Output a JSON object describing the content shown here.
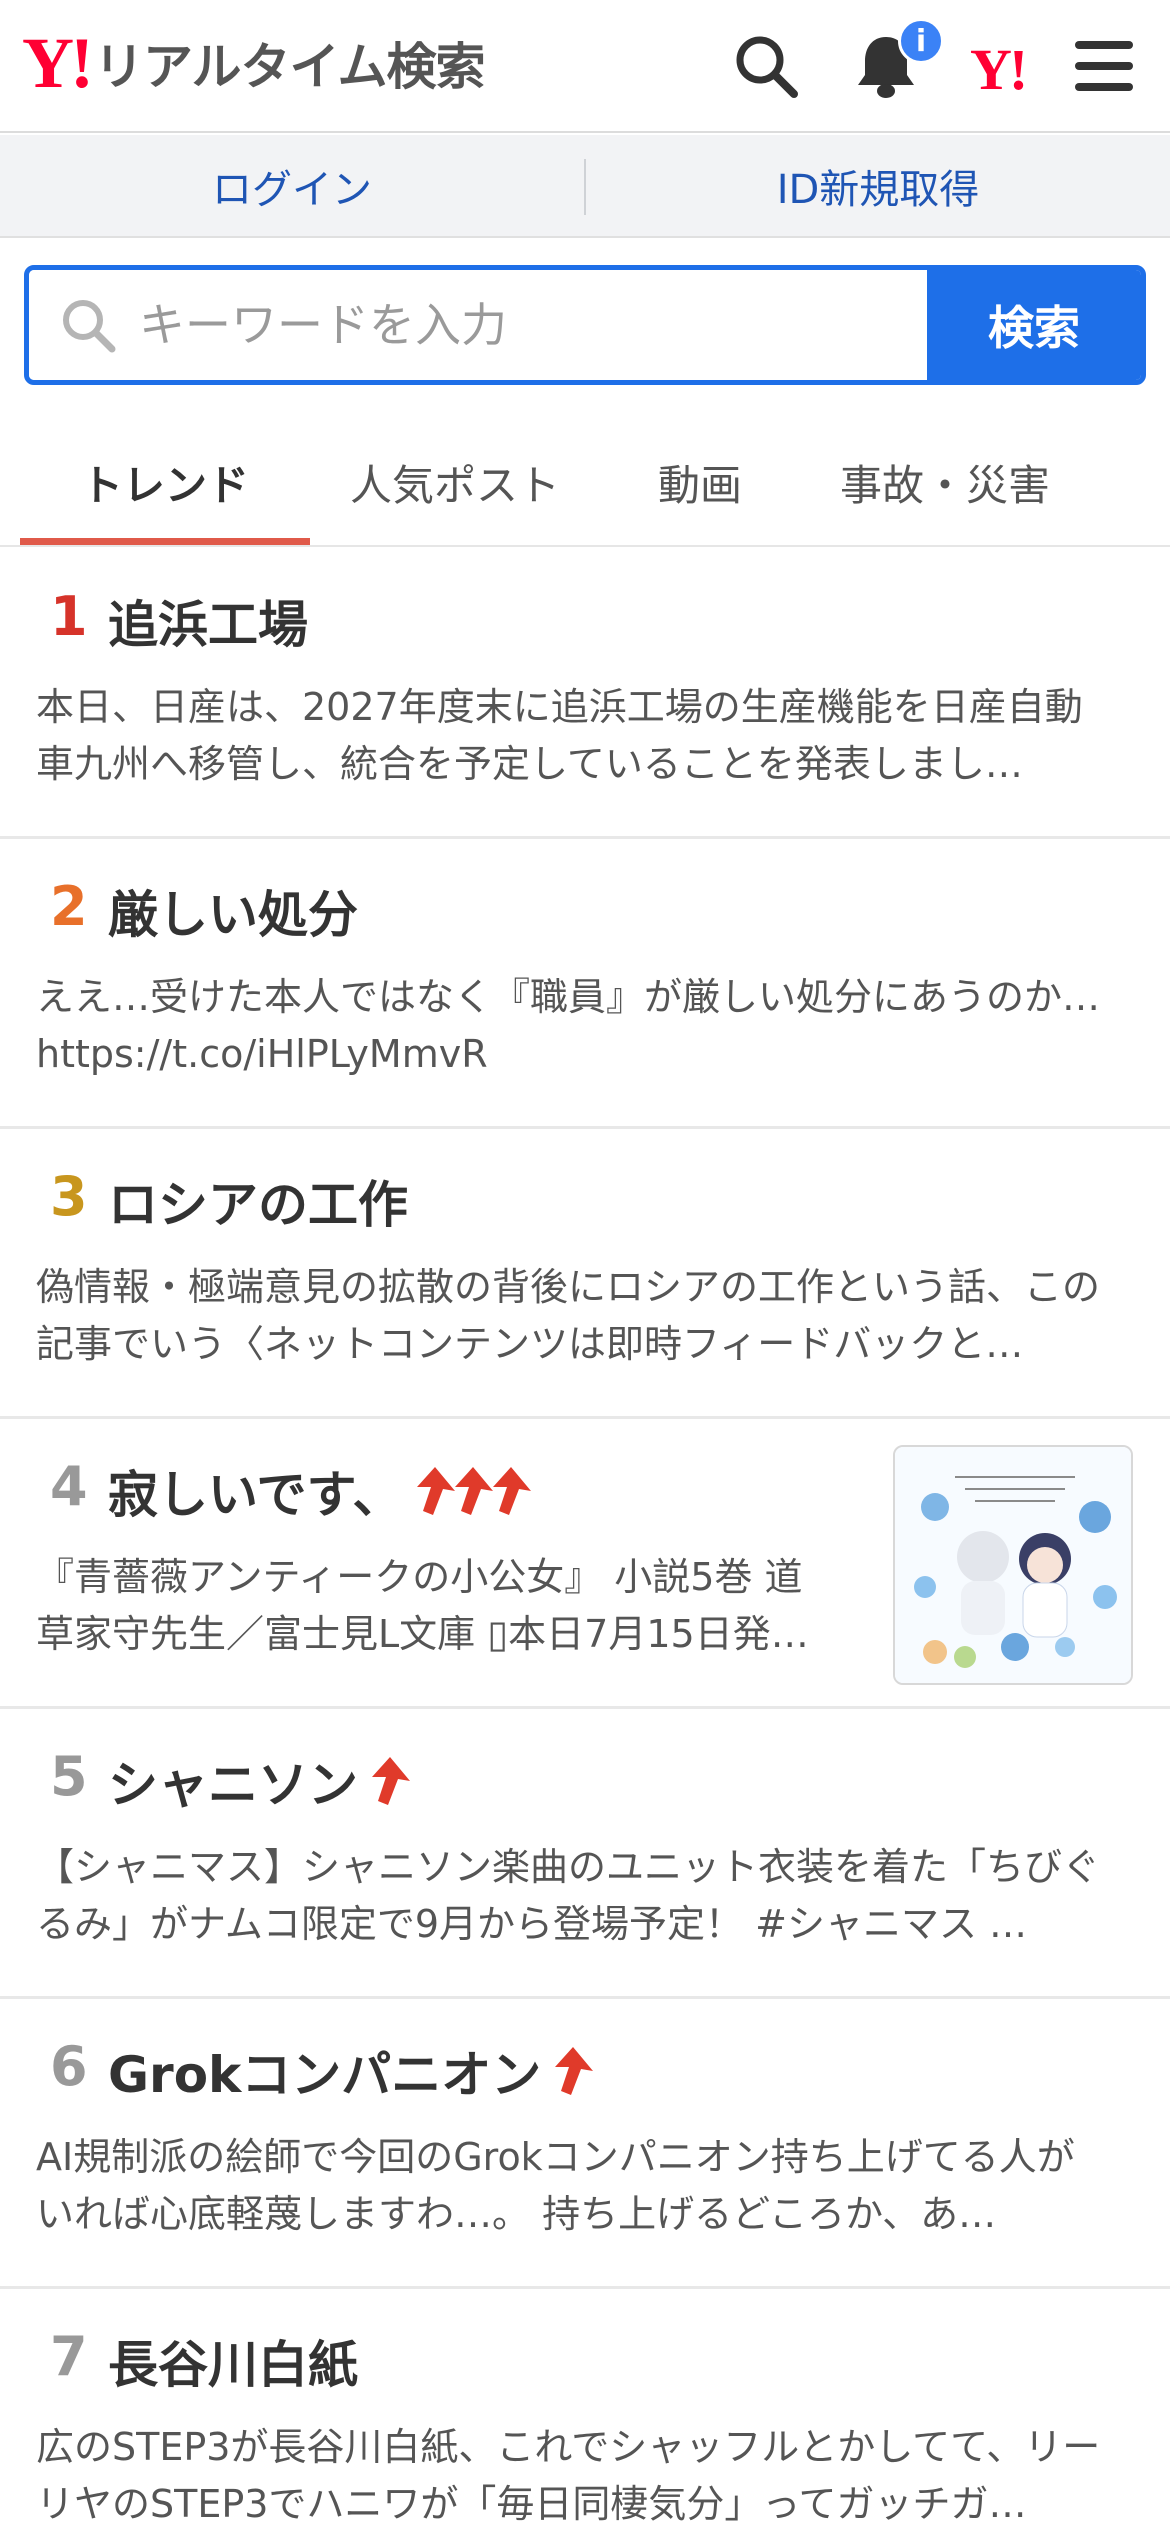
{
  "header": {
    "logo_mark": "Y!",
    "title": "リアルタイム検索",
    "notification_badge": "i",
    "yahoo_mark": "Y!"
  },
  "auth": {
    "login": "ログイン",
    "register": "ID新規取得"
  },
  "search": {
    "placeholder": "キーワードを入力",
    "value": "",
    "button": "検索"
  },
  "tabs": [
    {
      "label": "トレンド",
      "active": true
    },
    {
      "label": "人気ポスト",
      "active": false
    },
    {
      "label": "動画",
      "active": false
    },
    {
      "label": "事故・災害",
      "active": false
    }
  ],
  "colors": {
    "accent": "#1e6fe8",
    "brand": "#ff0033",
    "rank1": "#d6332a",
    "rank2": "#e8702a",
    "rank3": "#c8961e",
    "rank_other": "#999999",
    "trend_arrow": "#e03a2a"
  },
  "trends": [
    {
      "rank": "1",
      "title": "追浜工場",
      "arrows": 0,
      "desc": "本日、日産は、2027年度末に追浜工場の生産機能を日産自動車九州へ移管し、統合を予定していることを発表しまし…",
      "has_image": false
    },
    {
      "rank": "2",
      "title": "厳しい処分",
      "arrows": 0,
      "desc": "ええ…受けた本人ではなく『職員』が厳しい処分にあうのか… https://t.co/iHlPLyMmvR",
      "has_image": false
    },
    {
      "rank": "3",
      "title": "ロシアの工作",
      "arrows": 0,
      "desc": "偽情報・極端意見の拡散の背後にロシアの工作という話、この記事でいう〈ネットコンテンツは即時フィードバックと…",
      "has_image": false
    },
    {
      "rank": "4",
      "title": "寂しいです、",
      "arrows": 3,
      "desc": "『青薔薇アンティークの小公女』 小説5巻 道草家守先生／富士見L文庫 ▯本日7月15日発…",
      "has_image": true
    },
    {
      "rank": "5",
      "title": "シャニソン",
      "arrows": 1,
      "desc": "【シャニマス】シャニソン楽曲のユニット衣装を着た「ちびぐるみ」がナムコ限定で9月から登場予定！ #シャニマス …",
      "has_image": false
    },
    {
      "rank": "6",
      "title": "Grokコンパニオン",
      "arrows": 1,
      "desc": "AI規制派の絵師で今回のGrokコンパニオン持ち上げてる人がいれば心底軽蔑しますわ…。 持ち上げるどころか、あ…",
      "has_image": false
    },
    {
      "rank": "7",
      "title": "長谷川白紙",
      "arrows": 0,
      "desc": "広のSTEP3が長谷川白紙、これでシャッフルとかしてて、リーリヤのSTEP3でハニワが「毎日同棲気分」ってガッチガ…",
      "has_image": false
    }
  ]
}
